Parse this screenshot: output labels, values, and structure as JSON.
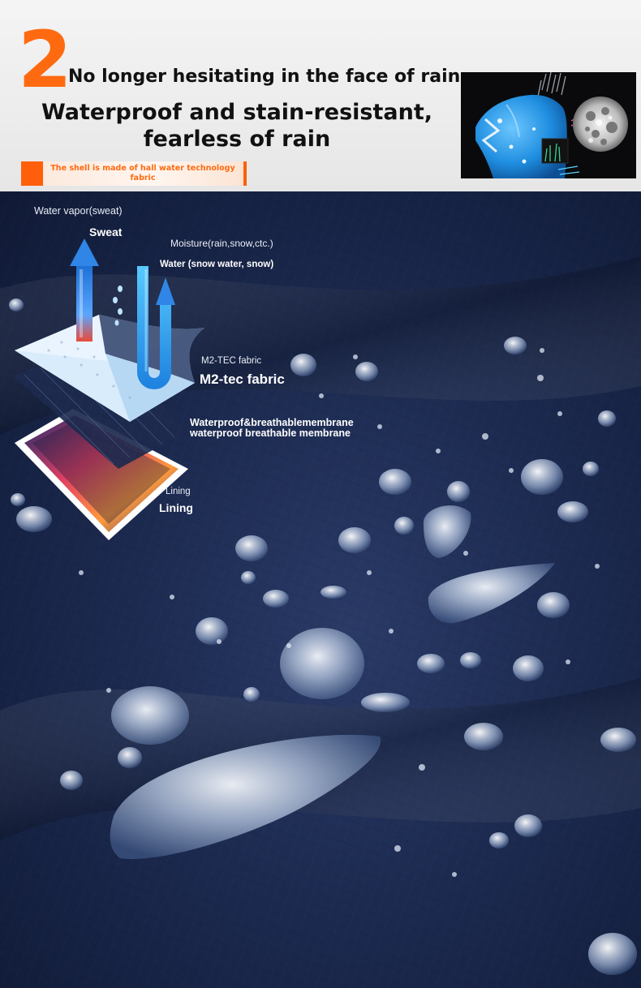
{
  "header": {
    "step_number": "2",
    "headline": "No longer hesitating in the face of rain",
    "title_line1": "Waterproof and stain-resistant,",
    "title_line2": "fearless of rain",
    "banner_text": "The shell is made of hall water technology fabric",
    "inset_image_icon": "jacket-waterproof-microscope-illustration",
    "accent_color": "#ff6a10"
  },
  "diagram": {
    "water_vapor_label": "Water vapor(sweat)",
    "sweat_label": "Sweat",
    "moisture_label": "Moisture(rain,snow,ctc.)",
    "water_label": "Water (snow water, snow)",
    "m2tec_small_label": "M2-TEC fabric",
    "m2tec_big_label": "M2-tec fabric",
    "membrane_label_1": "Waterproof&breathablemembrane",
    "membrane_label_2": "waterproof breathable membrane",
    "lining_small_label": "Lining",
    "lining_big_label": "Lining"
  },
  "colors": {
    "fabric_navy": "#1c2a50",
    "arrow_blue": "#2f86e6"
  }
}
